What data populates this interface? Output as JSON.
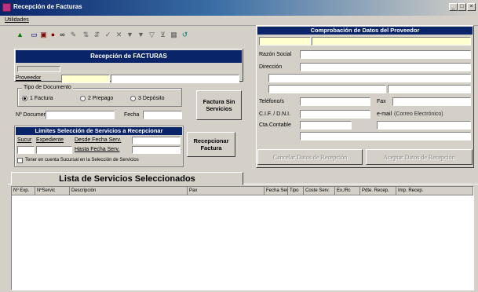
{
  "window": {
    "title": "Recepción de Facturas",
    "controls": [
      "_",
      "□",
      "×"
    ]
  },
  "menu": {
    "utilidades": "Utilidades"
  },
  "toolbar": {
    "icons": [
      {
        "name": "tool-icon",
        "glyph": "▲"
      },
      {
        "name": "document-icon",
        "glyph": "▭"
      },
      {
        "name": "print-icon",
        "glyph": "▣"
      },
      {
        "name": "person-icon",
        "glyph": "●"
      },
      {
        "name": "binoculars-icon",
        "glyph": "∞"
      },
      {
        "name": "pencil-icon",
        "glyph": "✎"
      },
      {
        "name": "sort-asc-icon",
        "glyph": "⇅"
      },
      {
        "name": "sort-desc-icon",
        "glyph": "⇵"
      },
      {
        "name": "check-icon",
        "glyph": "✓"
      },
      {
        "name": "delete-icon",
        "glyph": "✕"
      },
      {
        "name": "filter-icon",
        "glyph": "▼"
      },
      {
        "name": "filter-on-icon",
        "glyph": "▼"
      },
      {
        "name": "filter-off-icon",
        "glyph": "▽"
      },
      {
        "name": "apply-filter-icon",
        "glyph": "⊻"
      },
      {
        "name": "save-icon",
        "glyph": "▦"
      },
      {
        "name": "undo-icon",
        "glyph": "↺"
      }
    ]
  },
  "left": {
    "header": "Recepción de FACTURAS",
    "proveedor_label": "Proveedor",
    "tipo_doc_label": "Tipo de Documento",
    "radio_factura": "1 Factura",
    "radio_prepago": "2 Prepago",
    "radio_deposito": "3 Depósito",
    "num_documento_label": "Nº Documento",
    "fecha_label": "Fecha",
    "factura_sin_servicios": "Factura Sin Servicios",
    "limites_header": "Límites Selección de Servicios a Recepcionar",
    "sucursal_label": "Sucur",
    "expediente_label": "Expediente",
    "desde_fecha_label": "Desde Fecha Serv.",
    "hasta_fecha_label": "Hasta Fecha Serv.",
    "tener_en_cuenta": "Tener en cuenta Sucursal en la Selección de Servicios",
    "recepcionar_factura": "Recepcionar Factura"
  },
  "right": {
    "header": "Comprobación de Datos del Proveedor",
    "razon_social_label": "Razón Social",
    "direccion_label": "Dirección",
    "telefonos_label": "Teléfono/s",
    "fax_label": "Fax",
    "cif_label": "C.I.F. / D.N.I.",
    "email_label": "e-mail",
    "email_placeholder": "(Correo Electrónico)",
    "cta_contable_label": "Cta.Contable",
    "cancelar_btn": "Cancelar Datos de Recepción",
    "aceptar_btn": "Aceptar Datos de Recepción"
  },
  "tab": {
    "label": "Lista de Servicios Seleccionados"
  },
  "table": {
    "columns": [
      "Nº Exp.",
      "NºServic",
      "Descripción",
      "Pax",
      "Fecha Serv",
      "Tipo",
      "Coste Serv.",
      "Ex./Rc",
      "Pdte. Recep.",
      "Imp. Recep."
    ],
    "rows": []
  }
}
